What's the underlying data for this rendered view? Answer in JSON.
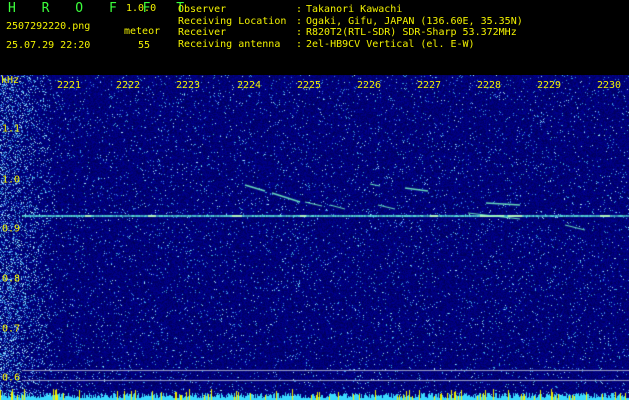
{
  "app": {
    "name": "H R O F F T",
    "version": "1.0.0"
  },
  "file": {
    "name": "2507292220.png",
    "datetime": "25.07.29 22:20"
  },
  "meteor": {
    "label": "meteor",
    "count": "55"
  },
  "info": [
    {
      "key": "Observer",
      "value": "Takanori Kawachi"
    },
    {
      "key": "Receiving Location",
      "value": "Ogaki, Gifu, JAPAN (136.60E, 35.35N)"
    },
    {
      "key": "Receiver",
      "value": "R820T2(RTL-SDR) SDR-Sharp 53.372MHz"
    },
    {
      "key": "Receiving antenna",
      "value": "2el-HB9CV Vertical (el. E-W)"
    }
  ],
  "axes": {
    "y_unit": "kHz",
    "x_ticks": [
      "2221",
      "2222",
      "2223",
      "2224",
      "2225",
      "2226",
      "2227",
      "2228",
      "2229",
      "2230"
    ],
    "y_ticks": [
      "1.1",
      "1.0",
      "0.9",
      "0.8",
      "0.7",
      "0.6"
    ]
  },
  "colors": {
    "label": "#f2f200",
    "brand": "#3cff3c",
    "background": "#000088",
    "trace": "#66ffcc"
  }
}
